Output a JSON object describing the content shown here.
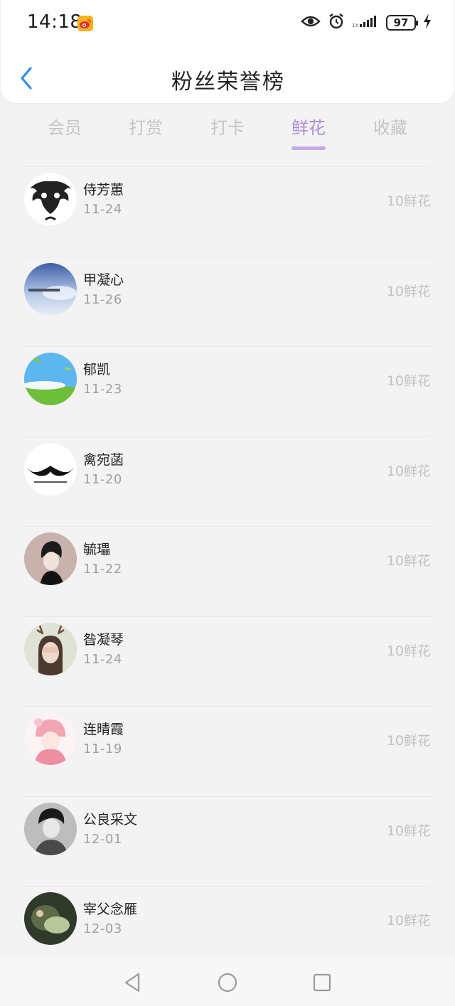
{
  "status_bar": {
    "time": "14:18",
    "battery": "97",
    "signal_label": "1X"
  },
  "header": {
    "title": "粉丝荣誉榜"
  },
  "tabs": [
    {
      "label": "会员",
      "active": false
    },
    {
      "label": "打赏",
      "active": false
    },
    {
      "label": "打卡",
      "active": false
    },
    {
      "label": "鲜花",
      "active": true
    },
    {
      "label": "收藏",
      "active": false
    }
  ],
  "fans": [
    {
      "name": "侍芳蕙",
      "date": "11-24",
      "amount": "10鲜花"
    },
    {
      "name": "甲凝心",
      "date": "11-26",
      "amount": "10鲜花"
    },
    {
      "name": "郁凯",
      "date": "11-23",
      "amount": "10鲜花"
    },
    {
      "name": "禽宛菡",
      "date": "11-20",
      "amount": "10鲜花"
    },
    {
      "name": "毓瓃",
      "date": "11-22",
      "amount": "10鲜花"
    },
    {
      "name": "昝凝琴",
      "date": "11-24",
      "amount": "10鲜花"
    },
    {
      "name": "连晴霞",
      "date": "11-19",
      "amount": "10鲜花"
    },
    {
      "name": "公良采文",
      "date": "12-01",
      "amount": "10鲜花"
    },
    {
      "name": "宰父念雁",
      "date": "12-03",
      "amount": "10鲜花"
    }
  ],
  "colors": {
    "accent": "#b08bd8",
    "underline": "#c9a8ea",
    "muted": "#c2c2c2"
  }
}
